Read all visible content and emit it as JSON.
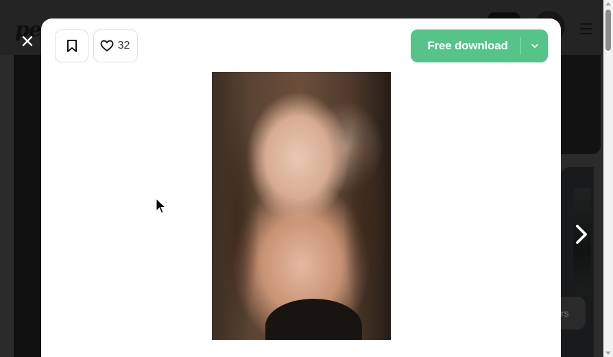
{
  "background": {
    "logo_text": "pe",
    "chip_text": "rs"
  },
  "toolbar": {
    "like_count": "32",
    "download_label": "Free download"
  },
  "photo": {
    "alt": "Portrait of a young woman with long brown hair looking out a window"
  },
  "colors": {
    "download_green": "#56c489",
    "overlay": "#1c1c1c",
    "modal_bg": "#ffffff"
  },
  "icons": {
    "close": "close-icon",
    "bookmark": "bookmark-icon",
    "like": "heart-icon",
    "dropdown": "chevron-down-icon",
    "next": "chevron-right-icon"
  }
}
